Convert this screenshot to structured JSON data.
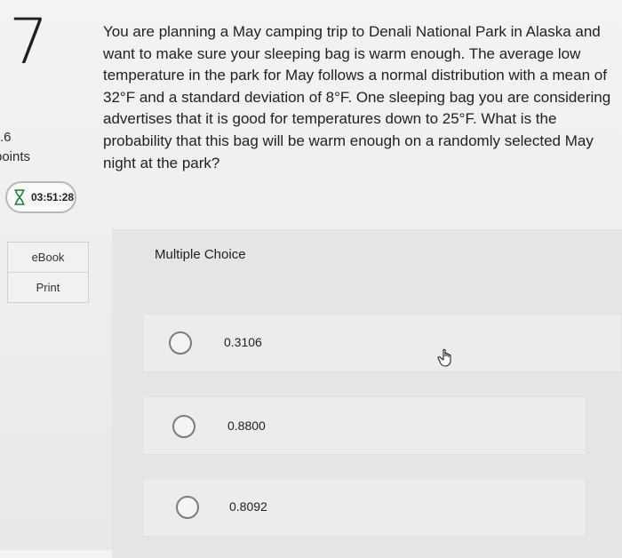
{
  "question": {
    "number": "7",
    "points_value": ".6",
    "points_label": "points",
    "text": "You are planning a May camping trip to Denali National Park in Alaska and want to make sure your sleeping bag is warm enough. The average low temperature in the park for May follows a normal distribution with a mean of 32°F and a standard deviation of 8°F. One sleeping bag you are considering advertises that it is good for temperatures down to 25°F. What is the probability that this bag will be warm enough on a randomly selected May night at the park?"
  },
  "timer": {
    "icon": "hourglass-icon",
    "time": "03:51:28"
  },
  "sidebar": {
    "links": [
      {
        "label": "eBook"
      },
      {
        "label": "Print"
      }
    ]
  },
  "answer_section": {
    "title": "Multiple Choice",
    "options": [
      {
        "label": "0.3106",
        "selected": false
      },
      {
        "label": "0.8800",
        "selected": false
      },
      {
        "label": "0.8092",
        "selected": false
      }
    ]
  },
  "colors": {
    "background": "#efefef",
    "panel": "#e5e5e5",
    "text": "#222222",
    "radio_border": "#7c7c7c"
  }
}
